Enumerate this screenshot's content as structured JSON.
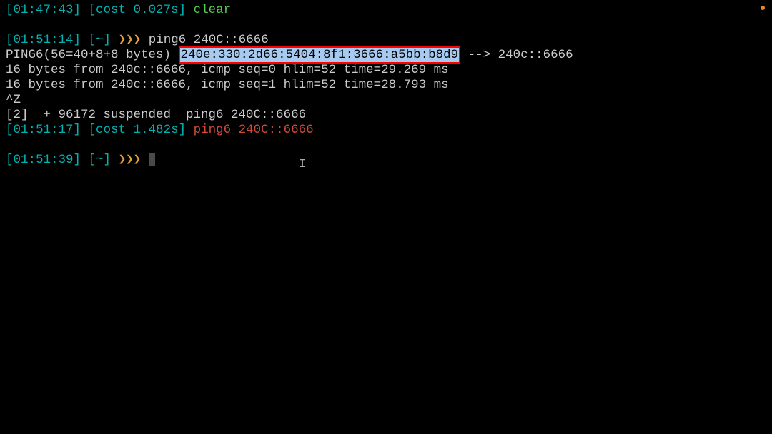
{
  "lines": {
    "l0": {
      "ts": "[01:47:43]",
      "cost": "[cost 0.027s]",
      "cmd": "clear"
    },
    "l1": {
      "ts": "[01:51:14]",
      "path": "[~]",
      "prompt": "❯❯❯",
      "cmd": "ping6 240C::6666"
    },
    "l2": {
      "prefix": "PING6(56=40+8+8 bytes) ",
      "highlight": "240e:330:2d66:5404:8f1:3666:a5bb:b8d9",
      "suffix": " --> 240c::6666"
    },
    "l3": "16 bytes from 240c::6666, icmp_seq=0 hlim=52 time=29.269 ms",
    "l4": "16 bytes from 240c::6666, icmp_seq=1 hlim=52 time=28.793 ms",
    "l5": "^Z",
    "l6": "[2]  + 96172 suspended  ping6 240C::6666",
    "l7": {
      "ts": "[01:51:17]",
      "cost": "[cost 1.482s]",
      "cmd": "ping6 240C::6666"
    },
    "l8": {
      "ts": "[01:51:39]",
      "path": "[~]",
      "prompt": "❯❯❯"
    }
  }
}
